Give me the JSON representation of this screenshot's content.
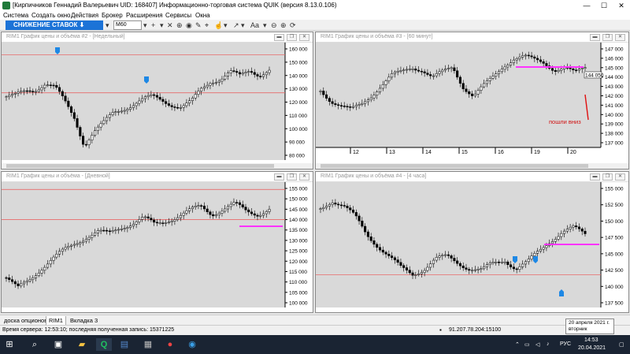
{
  "window": {
    "title": "[Кирпичников Геннадий Валерьевич UID: 168407] Информационно-торговая система QUIK (версия 8.13.0.106)",
    "minimize": "—",
    "maximize": "☐",
    "close": "✕"
  },
  "menu": [
    "Система",
    "Создать окно",
    "Действия",
    "Брокер",
    "Расширения",
    "Сервисы",
    "Окна"
  ],
  "toolbar": {
    "banner": "СНИЖЕНИЕ СТАВОК ⬇",
    "timeframe": "M60",
    "font_label": "Aa"
  },
  "windows": [
    {
      "title": "RIM1 График цены и объёма #2 - [Недельный]",
      "y_ticks": [
        "160 000",
        "150 000",
        "140 000",
        "130 000",
        "120 000",
        "110 000",
        "100 000",
        "90 000",
        "80 000"
      ],
      "hlines": [
        155500,
        127000
      ],
      "x_labels": []
    },
    {
      "title": "RIM1 График цены и объёма #3 - [60 минут]",
      "y_ticks": [
        "147 000",
        "146 000",
        "145 000",
        "144 000",
        "143 000",
        "142 000",
        "141 000",
        "140 000",
        "139 000",
        "138 000",
        "137 000"
      ],
      "price_box": "144 050",
      "note": "пошли вниз",
      "x_labels": [
        "12",
        "13",
        "14",
        "15",
        "16",
        "19",
        "20"
      ]
    },
    {
      "title": "RIM1 График цены и объёма - [Дневной]",
      "y_ticks": [
        "155 000",
        "150 000",
        "145 000",
        "140 000",
        "135 000",
        "130 000",
        "125 000",
        "120 000",
        "115 000",
        "110 000",
        "105 000",
        "100 000"
      ],
      "hlines": [
        154500,
        140000
      ],
      "x_labels": []
    },
    {
      "title": "RIM1 График цены и объёма #4 - [4 часа]",
      "y_ticks": [
        "155 000",
        "152 500",
        "150 000",
        "147 500",
        "145 000",
        "142 500",
        "140 000",
        "137 500"
      ],
      "hlines": [
        141800
      ],
      "x_labels": []
    }
  ],
  "tabs": [
    "доска опционов",
    "RIM1",
    "Вкладка 3"
  ],
  "status": {
    "server_time": "Время сервера: 12:53:10; последняя полученная запись: 15371225",
    "connection": "91.207.78.204:15100"
  },
  "tooltip": {
    "line1": "20 апреля 2021 г.",
    "line2": "вторник"
  },
  "tray": {
    "lang": "РУС",
    "time": "14:53",
    "date": "20.04.2021"
  },
  "colors": {
    "banner": "#1c73d7",
    "magenta": "#ff33ff",
    "red_line": "#e86a6a",
    "marker_blue": "#1e88e5"
  }
}
